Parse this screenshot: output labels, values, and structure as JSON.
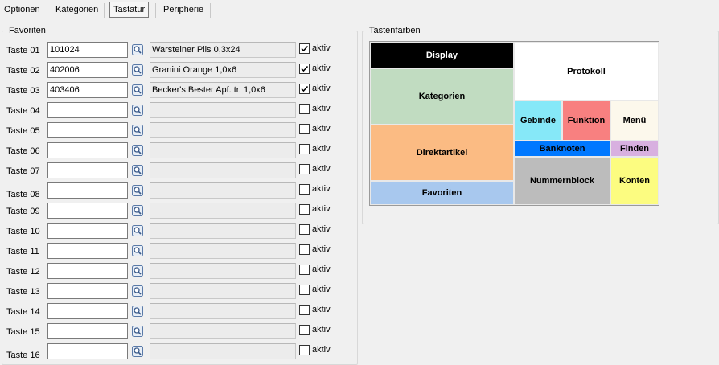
{
  "tabs": [
    {
      "label": "Optionen",
      "active": false
    },
    {
      "label": "Kategorien",
      "active": false
    },
    {
      "label": "Tastatur",
      "active": true
    },
    {
      "label": "Peripherie",
      "active": false
    }
  ],
  "favorites_group": {
    "title": "Favoriten",
    "rows": [
      {
        "label": "Taste 01",
        "code": "101024",
        "description": "Warsteiner Pils 0,3x24",
        "active": true,
        "active_label": "aktiv"
      },
      {
        "label": "Taste 02",
        "code": "402006",
        "description": "Granini Orange 1,0x6",
        "active": true,
        "active_label": "aktiv"
      },
      {
        "label": "Taste 03",
        "code": "403406",
        "description": "Becker's Bester Apf. tr. 1,0x6",
        "active": true,
        "active_label": "aktiv"
      },
      {
        "label": "Taste 04",
        "code": "",
        "description": "",
        "active": false,
        "active_label": "aktiv"
      },
      {
        "label": "Taste 05",
        "code": "",
        "description": "",
        "active": false,
        "active_label": "aktiv"
      },
      {
        "label": "Taste 06",
        "code": "",
        "description": "",
        "active": false,
        "active_label": "aktiv"
      },
      {
        "label": "Taste 07",
        "code": "",
        "description": "",
        "active": false,
        "active_label": "aktiv"
      },
      {
        "label": "Taste 08",
        "code": "",
        "description": "",
        "active": false,
        "active_label": "aktiv"
      },
      {
        "label": "Taste 09",
        "code": "",
        "description": "",
        "active": false,
        "active_label": "aktiv"
      },
      {
        "label": "Taste 10",
        "code": "",
        "description": "",
        "active": false,
        "active_label": "aktiv"
      },
      {
        "label": "Taste 11",
        "code": "",
        "description": "",
        "active": false,
        "active_label": "aktiv"
      },
      {
        "label": "Taste 12",
        "code": "",
        "description": "",
        "active": false,
        "active_label": "aktiv"
      },
      {
        "label": "Taste 13",
        "code": "",
        "description": "",
        "active": false,
        "active_label": "aktiv"
      },
      {
        "label": "Taste 14",
        "code": "",
        "description": "",
        "active": false,
        "active_label": "aktiv"
      },
      {
        "label": "Taste 15",
        "code": "",
        "description": "",
        "active": false,
        "active_label": "aktiv"
      },
      {
        "label": "Taste 16",
        "code": "",
        "description": "",
        "active": false,
        "active_label": "aktiv"
      }
    ],
    "lookup_icon": "search-lookup-icon"
  },
  "color_group": {
    "title": "Tastenfarben",
    "cells": [
      {
        "key": "display",
        "label": "Display",
        "bg": "#000000",
        "fg": "#ffffff"
      },
      {
        "key": "protokoll",
        "label": "Protokoll",
        "bg": "#ffffff",
        "fg": "#000000"
      },
      {
        "key": "kategorien",
        "label": "Kategorien",
        "bg": "#c1dcc1",
        "fg": "#000000"
      },
      {
        "key": "gebinde",
        "label": "Gebinde",
        "bg": "#86e8f8",
        "fg": "#000000"
      },
      {
        "key": "funktion",
        "label": "Funktion",
        "bg": "#f88080",
        "fg": "#000000"
      },
      {
        "key": "menu",
        "label": "Menü",
        "bg": "#fcf8ec",
        "fg": "#000000"
      },
      {
        "key": "direktartikel",
        "label": "Direktartikel",
        "bg": "#fbbb83",
        "fg": "#000000"
      },
      {
        "key": "banknoten",
        "label": "Banknoten",
        "bg": "#0078ff",
        "fg": "#000000"
      },
      {
        "key": "finden",
        "label": "Finden",
        "bg": "#d8b0e0",
        "fg": "#000000"
      },
      {
        "key": "nummernblock",
        "label": "Nummernblock",
        "bg": "#bcbcbc",
        "fg": "#000000"
      },
      {
        "key": "konten",
        "label": "Konten",
        "bg": "#fcfc80",
        "fg": "#000000"
      },
      {
        "key": "favoriten",
        "label": "Favoriten",
        "bg": "#a8c8ee",
        "fg": "#000000"
      }
    ]
  }
}
